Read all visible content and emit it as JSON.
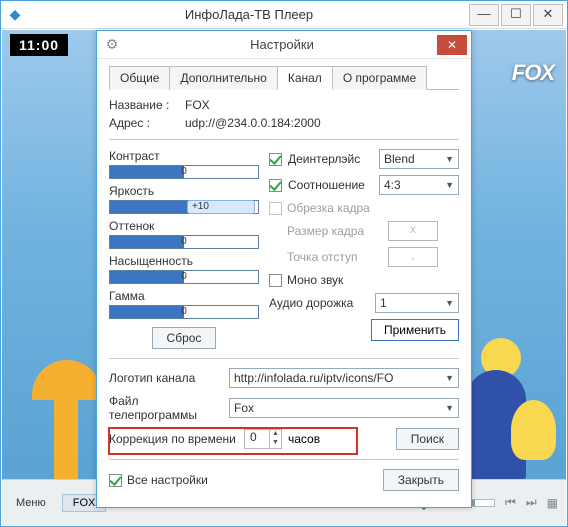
{
  "outer": {
    "title": "ИнфоЛада-ТВ Плеер",
    "minimize": "—",
    "maximize": "☐",
    "close": "✕"
  },
  "video": {
    "clock": "11:00",
    "brand": "FOX"
  },
  "playerbar": {
    "menu": "Меню",
    "channel": "FOX"
  },
  "dialog": {
    "title": "Настройки",
    "close": "✕",
    "tabs": {
      "general": "Общие",
      "extra": "Дополнительно",
      "channel": "Канал",
      "about": "О программе"
    },
    "name_label": "Название :",
    "name_value": "FOX",
    "addr_label": "Адрес :",
    "addr_value": "udp://@234.0.0.184:2000",
    "sliders": {
      "contrast": {
        "label": "Контраст",
        "value": "0"
      },
      "brightness": {
        "label": "Яркость",
        "value": "+10"
      },
      "hue": {
        "label": "Оттенок",
        "value": "0"
      },
      "saturation": {
        "label": "Насыщенность",
        "value": "0"
      },
      "gamma": {
        "label": "Гамма",
        "value": "0"
      }
    },
    "reset": "Сброс",
    "right": {
      "deinterlace": "Деинтерлэйс",
      "deinterlace_val": "Blend",
      "aspect": "Соотношение",
      "aspect_val": "4:3",
      "crop": "Обрезка кадра",
      "crop_size": "Размер кадра",
      "crop_size_val": "x",
      "crop_point": "Точка отступ",
      "crop_point_val": ",",
      "mono": "Моно звук",
      "track": "Аудио дорожка",
      "track_val": "1",
      "apply": "Применить"
    },
    "lower": {
      "logo_label": "Логотип канала",
      "logo_val": "http://infolada.ru/iptv/icons/FO",
      "epg_label": "Файл телепрограммы",
      "epg_val": "Fox",
      "tz_label": "Коррекция по времени",
      "tz_val": "0",
      "tz_unit": "часов",
      "search": "Поиск"
    },
    "all_settings": "Все настройки",
    "close_btn": "Закрыть"
  }
}
